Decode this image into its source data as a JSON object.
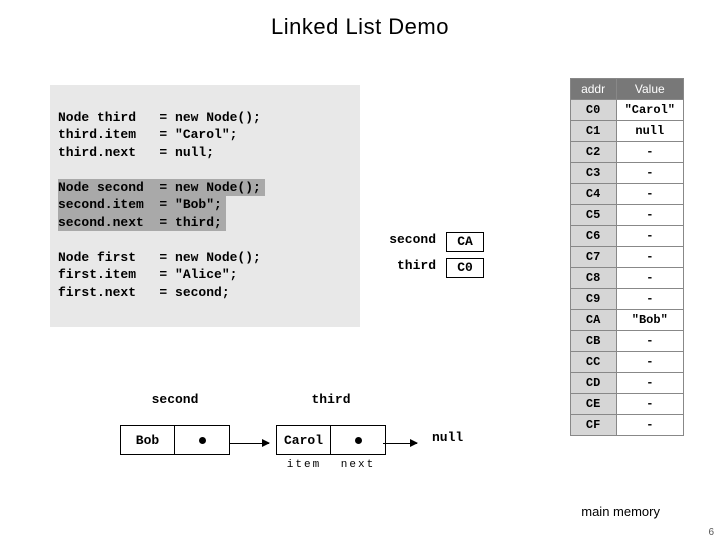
{
  "title": "Linked List Demo",
  "code": {
    "l1": "Node third   = new Node();",
    "l2": "third.item   = \"Carol\";",
    "l3": "third.next   = null;",
    "l4": "Node second  = new Node();",
    "l5": "second.item  = \"Bob\";",
    "l6": "second.next  = third;",
    "l7": "Node first   = new Node();",
    "l8": "first.item   = \"Alice\";",
    "l9": "first.next   = second;"
  },
  "pointers": {
    "second_name": "second",
    "second_addr": "CA",
    "third_name": "third",
    "third_addr": "C0"
  },
  "memory": {
    "header_addr": "addr",
    "header_value": "Value",
    "rows": [
      {
        "addr": "C0",
        "value": "\"Carol\""
      },
      {
        "addr": "C1",
        "value": "null"
      },
      {
        "addr": "C2",
        "value": "-"
      },
      {
        "addr": "C3",
        "value": "-"
      },
      {
        "addr": "C4",
        "value": "-"
      },
      {
        "addr": "C5",
        "value": "-"
      },
      {
        "addr": "C6",
        "value": "-"
      },
      {
        "addr": "C7",
        "value": "-"
      },
      {
        "addr": "C8",
        "value": "-"
      },
      {
        "addr": "C9",
        "value": "-"
      },
      {
        "addr": "CA",
        "value": "\"Bob\""
      },
      {
        "addr": "CB",
        "value": "-"
      },
      {
        "addr": "CC",
        "value": "-"
      },
      {
        "addr": "CD",
        "value": "-"
      },
      {
        "addr": "CE",
        "value": "-"
      },
      {
        "addr": "CF",
        "value": "-"
      }
    ],
    "label": "main memory"
  },
  "nodes": {
    "second_label": "second",
    "second_item": "Bob",
    "third_label": "third",
    "third_item": "Carol",
    "null_label": "null",
    "item_caption": "item",
    "next_caption": "next"
  },
  "page_number": "6"
}
